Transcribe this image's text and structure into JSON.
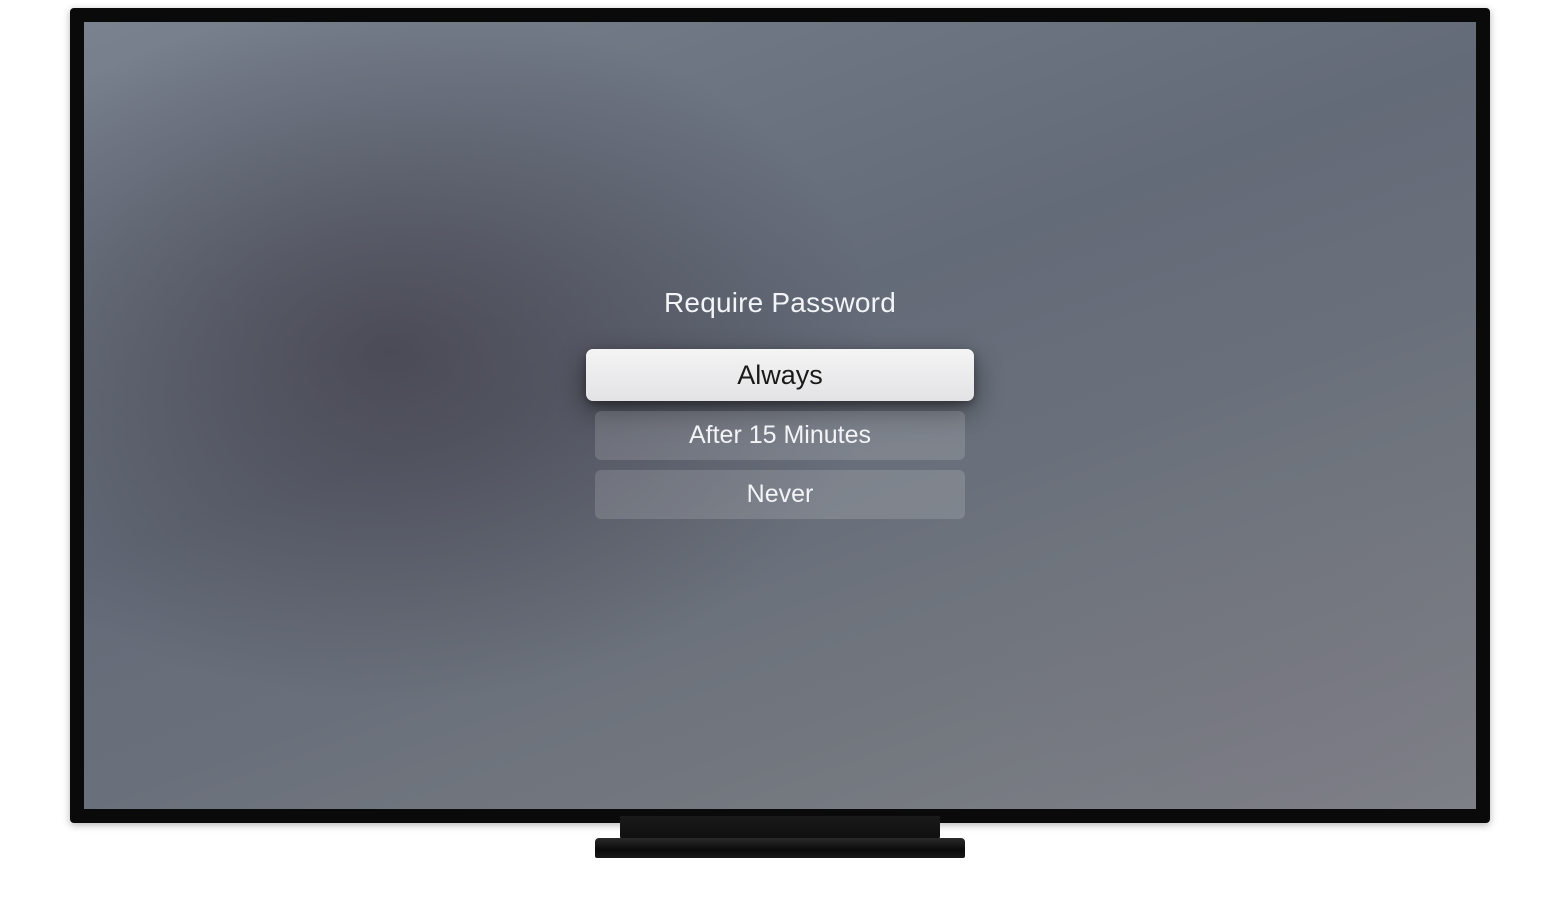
{
  "dialog": {
    "title": "Require Password",
    "options": [
      {
        "label": "Always",
        "focused": true
      },
      {
        "label": "After 15 Minutes",
        "focused": false
      },
      {
        "label": "Never",
        "focused": false
      }
    ]
  }
}
